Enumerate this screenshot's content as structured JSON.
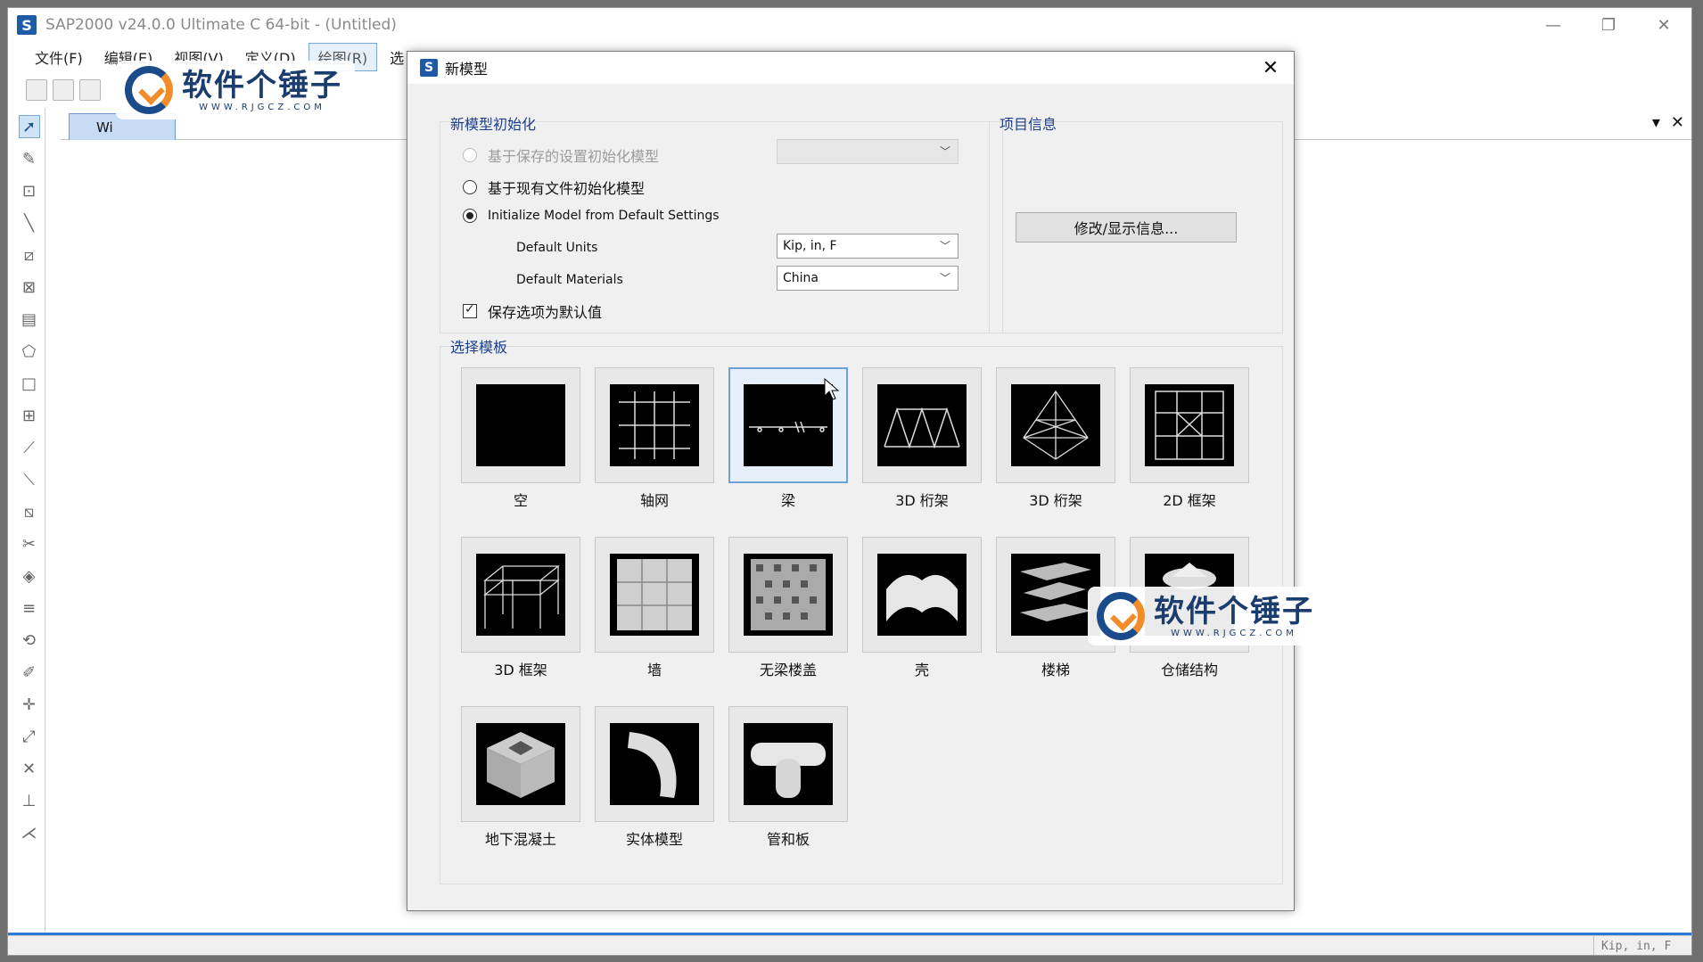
{
  "app": {
    "title": "SAP2000 v24.0.0 Ultimate C 64-bit - (Untitled)",
    "logo_letter": "S",
    "menus": [
      "文件(F)",
      "编辑(E)",
      "视图(V)",
      "定义(D)",
      "绘图(R)",
      "选"
    ],
    "tab_label": "Wi",
    "status_units": "Kip, in, F",
    "win_min": "—",
    "win_restore": "❐",
    "win_close": "✕",
    "tab_dropdown": "▾",
    "tab_close": "✕"
  },
  "watermark": {
    "title": "软件个锤子",
    "sub": "WWW.RJGCZ.COM"
  },
  "dialog": {
    "title": "新模型",
    "close": "✕",
    "init_group": {
      "label": "新模型初始化",
      "option_saved": "基于保存的设置初始化模型",
      "option_existing": "基于现有文件初始化模型",
      "option_default": "Initialize Model from Default Settings",
      "selected": "option_default",
      "units_label": "Default Units",
      "units_value": "Kip, in, F",
      "materials_label": "Default Materials",
      "materials_value": "China",
      "save_default_label": "保存选项为默认值",
      "save_default_checked": true
    },
    "project_group": {
      "label": "项目信息",
      "button": "修改/显示信息..."
    },
    "template_group": {
      "label": "选择模板",
      "selected": "梁",
      "templates": [
        {
          "label": "空",
          "icon": "blank-icon"
        },
        {
          "label": "轴网",
          "icon": "grid-icon"
        },
        {
          "label": "梁",
          "icon": "beam-icon"
        },
        {
          "label": "3D 桁架",
          "icon": "truss-3d-icon"
        },
        {
          "label": "3D 桁架",
          "icon": "truss-3d-tower-icon"
        },
        {
          "label": "2D 框架",
          "icon": "frame-2d-icon"
        },
        {
          "label": "3D 框架",
          "icon": "frame-3d-icon"
        },
        {
          "label": "墙",
          "icon": "wall-icon"
        },
        {
          "label": "无梁楼盖",
          "icon": "flat-slab-icon"
        },
        {
          "label": "壳",
          "icon": "shell-icon"
        },
        {
          "label": "楼梯",
          "icon": "stair-icon"
        },
        {
          "label": "仓储结构",
          "icon": "storage-icon"
        },
        {
          "label": "地下混凝土",
          "icon": "underground-concrete-icon"
        },
        {
          "label": "实体模型",
          "icon": "solid-model-icon"
        },
        {
          "label": "管和板",
          "icon": "pipe-plate-icon"
        }
      ]
    }
  }
}
